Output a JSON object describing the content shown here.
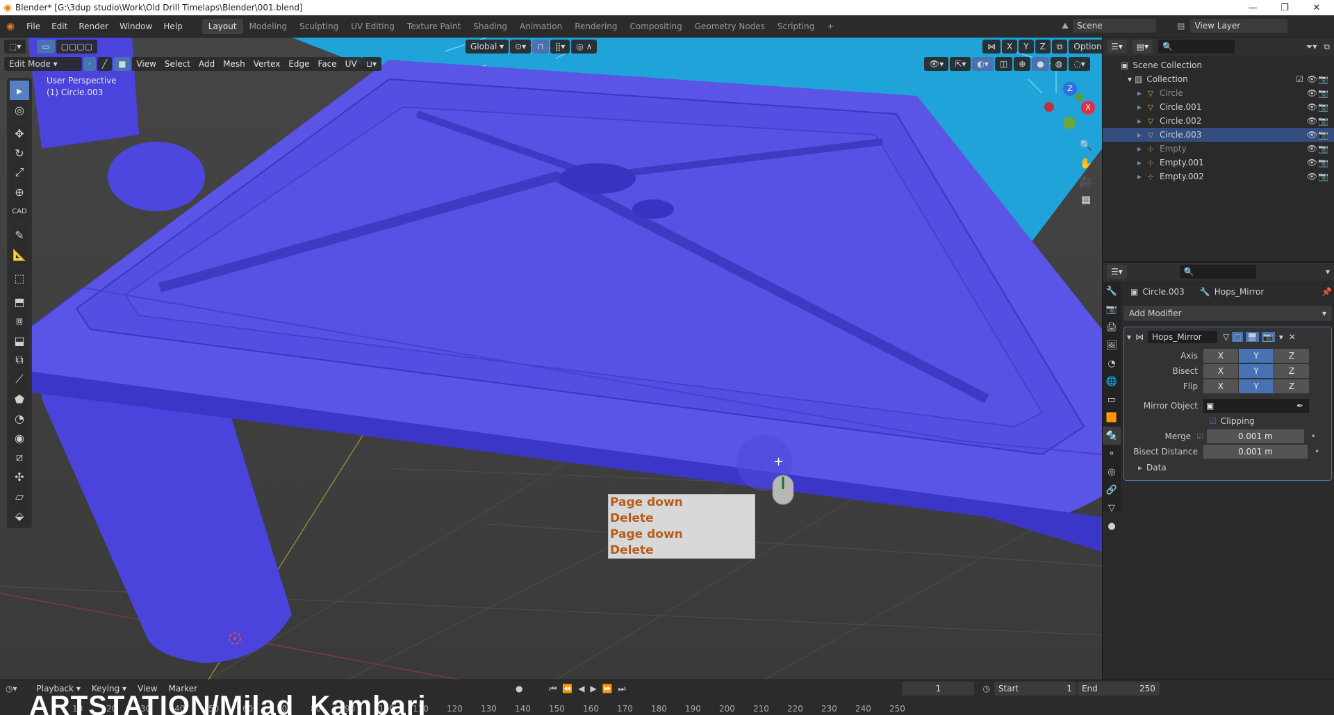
{
  "titlebar": {
    "title": "Blender* [G:\\3dup studio\\Work\\Old Drill Timelaps\\Blender\\001.blend]",
    "minimize": "—",
    "maximize": "❐",
    "close": "✕"
  },
  "menus": [
    "File",
    "Edit",
    "Render",
    "Window",
    "Help"
  ],
  "workspaces": [
    "Layout",
    "Modeling",
    "Sculpting",
    "UV Editing",
    "Texture Paint",
    "Shading",
    "Animation",
    "Rendering",
    "Compositing",
    "Geometry Nodes",
    "Scripting",
    "+"
  ],
  "scene": {
    "label": "Scene",
    "view_layer": "View Layer"
  },
  "viewport": {
    "mode": "Edit Mode",
    "header_menus": [
      "View",
      "Select",
      "Add",
      "Mesh",
      "Vertex",
      "Edge",
      "Face",
      "UV"
    ],
    "transform_orientation": "Global",
    "options": "Options",
    "axis_toggles": [
      "X",
      "Y",
      "Z"
    ],
    "overlay_line1": "User Perspective",
    "overlay_line2": "(1) Circle.003",
    "gizmo": {
      "z": "Z",
      "y": "Y",
      "x": "X"
    }
  },
  "key_display": [
    "Page down",
    "Delete",
    "Page down",
    "Delete"
  ],
  "outliner": {
    "root": "Scene Collection",
    "collection": "Collection",
    "items": [
      {
        "name": "Circle",
        "dim": true,
        "selected": false
      },
      {
        "name": "Circle.001",
        "dim": false,
        "selected": false
      },
      {
        "name": "Circle.002",
        "dim": false,
        "selected": false
      },
      {
        "name": "Circle.003",
        "dim": false,
        "selected": true
      },
      {
        "name": "Empty",
        "dim": true,
        "selected": false
      },
      {
        "name": "Empty.001",
        "dim": false,
        "selected": false
      },
      {
        "name": "Empty.002",
        "dim": false,
        "selected": false
      }
    ]
  },
  "properties": {
    "object": "Circle.003",
    "modifier_name_breadcrumb": "Hops_Mirror",
    "add_modifier": "Add Modifier",
    "modifier_name": "Hops_Mirror",
    "axis_label": "Axis",
    "bisect_label": "Bisect",
    "flip_label": "Flip",
    "axes": [
      "X",
      "Y",
      "Z"
    ],
    "mirror_object_label": "Mirror Object",
    "clipping_label": "Clipping",
    "merge_label": "Merge",
    "merge_value": "0.001 m",
    "bisect_distance_label": "Bisect Distance",
    "bisect_distance_value": "0.001 m",
    "data_label": "Data"
  },
  "timeline": {
    "menus": [
      "Playback",
      "Keying",
      "View",
      "Marker"
    ],
    "current_frame": "1",
    "start_label": "Start",
    "start": "1",
    "end_label": "End",
    "end": "250",
    "ticks": [
      "10",
      "20",
      "30",
      "40",
      "50",
      "60",
      "70",
      "80",
      "90",
      "100",
      "110",
      "120",
      "130",
      "140",
      "150",
      "160",
      "170",
      "180",
      "190",
      "200",
      "210",
      "220",
      "230",
      "240",
      "250"
    ]
  },
  "watermark": "ARTSTATION/Milad_Kambari",
  "colors": {
    "mesh": "#5a55e6",
    "mesh_dark": "#3c36c8",
    "accent": "#4772b3",
    "selected_row": "#334d80",
    "cyan_bg": "#1fa3d8",
    "key_text": "#b85b1a"
  }
}
